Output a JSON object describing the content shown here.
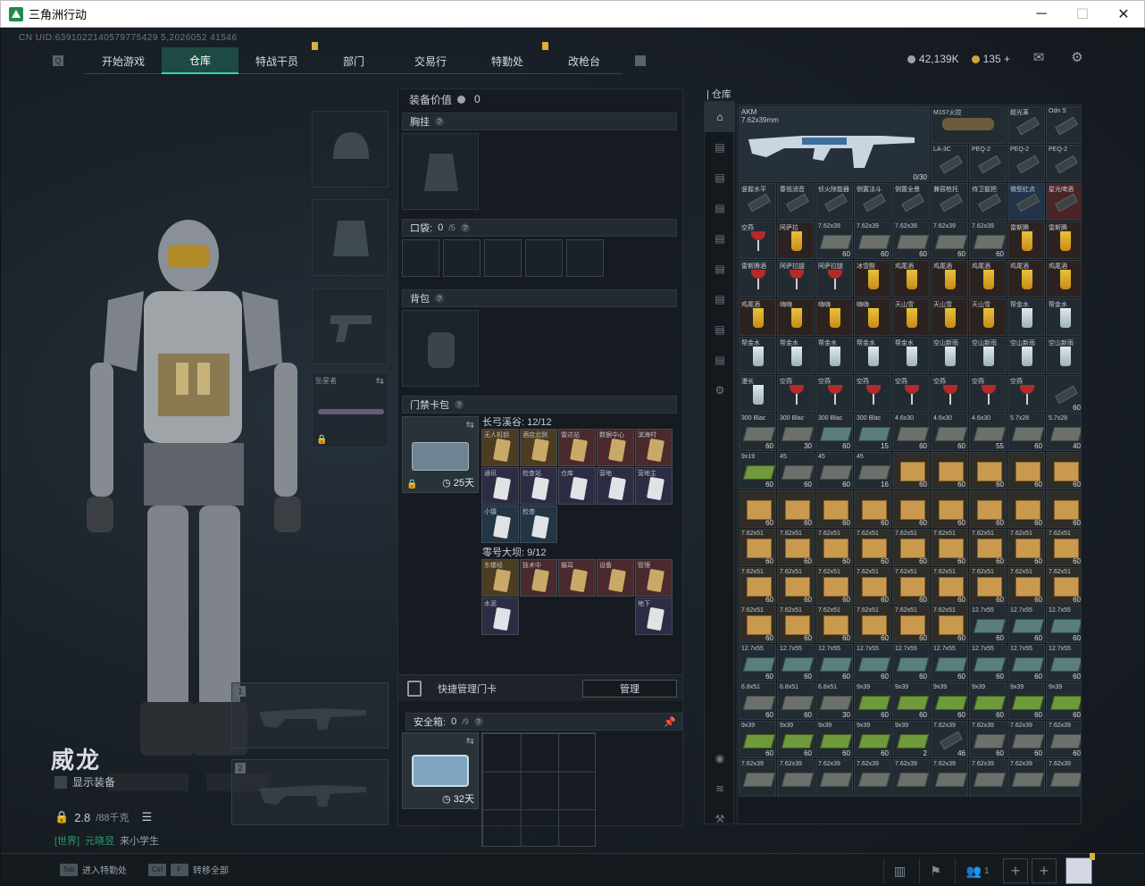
{
  "window": {
    "title": "三角洲行动",
    "min_icon": "minimize-icon",
    "max_icon": "maximize-icon",
    "close_icon": "close-icon"
  },
  "uid": "CN UID:6391022140579775429 5,2026052 41546",
  "nav": {
    "tabs": [
      {
        "label": "开始游戏"
      },
      {
        "label": "仓库",
        "active": true
      },
      {
        "label": "特战干员",
        "badge": true
      },
      {
        "label": "部门"
      },
      {
        "label": "交易行"
      },
      {
        "label": "特勤处",
        "badge": true
      },
      {
        "label": "改枪台"
      }
    ]
  },
  "currency": {
    "coins": "42,139K",
    "premium": "135",
    "plus": "+"
  },
  "character": {
    "name": "威龙",
    "show_gear": "显示装备",
    "weight": "2.8",
    "weight_max": "/88千克",
    "chat_channel": "[世界]",
    "chat_name": "元晓昱",
    "chat_text": "来小学生"
  },
  "melee": {
    "name": "坠星者"
  },
  "weapon_slots": {
    "slot1": "1",
    "slot2": "2"
  },
  "loadout": {
    "equip_value_label": "装备价值",
    "equip_value": "0",
    "chest_rig": "胸挂",
    "pockets": "口袋:",
    "pockets_count": "0",
    "pockets_max": "/5",
    "backpack": "背包",
    "keycase": "门禁卡包",
    "keycase_days": "25天",
    "zone1": "长弓溪谷: 12/12",
    "zone2": "零号大坝: 9/12",
    "quick_manage": "快捷管理门卡",
    "manage_btn": "管理",
    "safe_box": "安全箱:",
    "safe_count": "0",
    "safe_max": "/9",
    "safe_days": "32天"
  },
  "zone1_cards": [
    {
      "name": "无人机钥",
      "tone": "gold"
    },
    {
      "name": "酒店北侧",
      "tone": "gold"
    },
    {
      "name": "雷达站",
      "tone": "red"
    },
    {
      "name": "数据中心",
      "tone": "red"
    },
    {
      "name": "滨海村",
      "tone": "red"
    },
    {
      "name": "通讯",
      "tone": "purple"
    },
    {
      "name": "检查站",
      "tone": "purple"
    },
    {
      "name": "仓库",
      "tone": "purple"
    },
    {
      "name": "营地",
      "tone": "purple"
    },
    {
      "name": "营地主",
      "tone": "purple"
    },
    {
      "name": "小镇",
      "tone": "blue"
    },
    {
      "name": "检查",
      "tone": "blue"
    }
  ],
  "zone2_cards": [
    {
      "name": "东楼经",
      "tone": "gold"
    },
    {
      "name": "技术中",
      "tone": "red"
    },
    {
      "name": "猫耳",
      "tone": "red"
    },
    {
      "name": "设备",
      "tone": "red"
    },
    {
      "name": "管理",
      "tone": "red"
    },
    {
      "name": "水泥",
      "tone": "purple"
    },
    {
      "name": "",
      "tone": "empty"
    },
    {
      "name": "",
      "tone": "empty"
    },
    {
      "name": "",
      "tone": "empty"
    },
    {
      "name": "地下",
      "tone": "purple"
    }
  ],
  "warehouse": {
    "title": "仓库",
    "gun_name": "AKM",
    "gun_caliber": "7.62x39mm",
    "gun_ammo": "0/30",
    "scope_name": "M157火控",
    "tabs": [
      "home-icon",
      "ST",
      "ST",
      "SD",
      "TV",
      "TV",
      "TV",
      "TV",
      "TV",
      "settings-icon"
    ],
    "bottom_tabs": [
      "camera-icon",
      "layers-icon",
      "tool-icon"
    ]
  },
  "wh_small_top": [
    {
      "name": "超光革",
      "t": "att"
    },
    {
      "name": "Odn S",
      "t": "att"
    },
    {
      "name": "LA-3C",
      "t": "att"
    },
    {
      "name": "PEQ-2",
      "t": "att"
    },
    {
      "name": "PEQ-2",
      "t": "att"
    },
    {
      "name": "PEQ-2",
      "t": "att"
    }
  ],
  "wh_items": [
    {
      "name": "竖握水平",
      "t": "att"
    },
    {
      "name": "春祖消音",
      "t": "att"
    },
    {
      "name": "侦火除能器",
      "t": "att"
    },
    {
      "name": "侧置法斗",
      "t": "att"
    },
    {
      "name": "侧置全景",
      "t": "att"
    },
    {
      "name": "兼容枪托",
      "t": "att"
    },
    {
      "name": "侍卫握把",
      "t": "att"
    },
    {
      "name": "微型红点",
      "t": "att blue"
    },
    {
      "name": "星光啤酒",
      "t": "att red"
    },
    {
      "name": "空燕",
      "t": "drinkr"
    },
    {
      "name": "阿萨拉",
      "t": "drink"
    },
    {
      "name": "7.62x39",
      "t": "ammo",
      "c": "60"
    },
    {
      "name": "7.62x39",
      "t": "ammo",
      "c": "60"
    },
    {
      "name": "7.62x39",
      "t": "ammo",
      "c": "60"
    },
    {
      "name": "7.62x39",
      "t": "ammo",
      "c": "60"
    },
    {
      "name": "7.62x39",
      "t": "ammo",
      "c": "60"
    },
    {
      "name": "雷斯腾",
      "t": "drink"
    },
    {
      "name": "雷斯腾",
      "t": "drink"
    },
    {
      "name": "雷斯腾酒",
      "t": "drinkr"
    },
    {
      "name": "阿萨拉腿",
      "t": "drinkr"
    },
    {
      "name": "阿萨拉腿",
      "t": "drinkr"
    },
    {
      "name": "冰雪酸",
      "t": "drink"
    },
    {
      "name": "鸡尾酒",
      "t": "drink"
    },
    {
      "name": "鸡尾酒",
      "t": "drink"
    },
    {
      "name": "鸡尾酒",
      "t": "drink"
    },
    {
      "name": "鸡尾酒",
      "t": "drink"
    },
    {
      "name": "鸡尾酒",
      "t": "drink"
    },
    {
      "name": "鸡尾酒",
      "t": "drink"
    },
    {
      "name": "嗨嗨",
      "t": "drink"
    },
    {
      "name": "嗨嗨",
      "t": "drink"
    },
    {
      "name": "嗨嗨",
      "t": "drink"
    },
    {
      "name": "天山雪",
      "t": "drink"
    },
    {
      "name": "天山雪",
      "t": "drink"
    },
    {
      "name": "天山雪",
      "t": "drink"
    },
    {
      "name": "帮金水",
      "t": "drinkc"
    },
    {
      "name": "帮金水",
      "t": "drinkc"
    },
    {
      "name": "帮金水",
      "t": "drinkc"
    },
    {
      "name": "帮金水",
      "t": "drinkc"
    },
    {
      "name": "帮金水",
      "t": "drinkc"
    },
    {
      "name": "帮金水",
      "t": "drinkc"
    },
    {
      "name": "帮金水",
      "t": "drinkc"
    },
    {
      "name": "空山新雨",
      "t": "drinkc"
    },
    {
      "name": "空山新雨",
      "t": "drinkc"
    },
    {
      "name": "空山新雨",
      "t": "drinkc"
    },
    {
      "name": "空山新雨",
      "t": "drinkc"
    },
    {
      "name": "漫长",
      "t": "drinkc"
    },
    {
      "name": "空燕",
      "t": "drinkr"
    },
    {
      "name": "空燕",
      "t": "drinkr"
    },
    {
      "name": "空燕",
      "t": "drinkr"
    },
    {
      "name": "空燕",
      "t": "drinkr"
    },
    {
      "name": "空燕",
      "t": "drinkr"
    },
    {
      "name": "空燕",
      "t": "drinkr"
    },
    {
      "name": "空燕",
      "t": "drinkr"
    },
    {
      "name": "",
      "t": "att",
      "c": "60"
    },
    {
      "name": "300 Blac",
      "t": "ammo",
      "c": "60"
    },
    {
      "name": "300 Blac",
      "t": "ammo",
      "c": "30"
    },
    {
      "name": "300 Blac",
      "t": "ammob",
      "c": "60"
    },
    {
      "name": "300 Blac",
      "t": "ammob",
      "c": "15"
    },
    {
      "name": "4.6x30",
      "t": "ammo",
      "c": "60"
    },
    {
      "name": "4.6x30",
      "t": "ammo",
      "c": "60"
    },
    {
      "name": "4.6x30",
      "t": "ammo",
      "c": "55"
    },
    {
      "name": "5.7x28",
      "t": "ammo",
      "c": "60"
    },
    {
      "name": "5.7x28",
      "t": "ammo",
      "c": "40"
    },
    {
      "name": "9x19",
      "t": "ammog",
      "c": "60"
    },
    {
      "name": "45",
      "t": "ammo",
      "c": "60"
    },
    {
      "name": "45",
      "t": "ammo",
      "c": "60"
    },
    {
      "name": "45",
      "t": "ammo",
      "c": "16"
    },
    {
      "name": "",
      "t": "crate",
      "c": "60"
    },
    {
      "name": "",
      "t": "crate",
      "c": "60"
    },
    {
      "name": "",
      "t": "crate",
      "c": "60"
    },
    {
      "name": "",
      "t": "crate",
      "c": "60"
    },
    {
      "name": "",
      "t": "crate",
      "c": "60"
    },
    {
      "name": "",
      "t": "crate",
      "c": "60"
    },
    {
      "name": "",
      "t": "crate",
      "c": "60"
    },
    {
      "name": "",
      "t": "crate",
      "c": "60"
    },
    {
      "name": "",
      "t": "crate",
      "c": "60"
    },
    {
      "name": "",
      "t": "crate",
      "c": "60"
    },
    {
      "name": "",
      "t": "crate",
      "c": "60"
    },
    {
      "name": "",
      "t": "crate",
      "c": "60"
    },
    {
      "name": "",
      "t": "crate",
      "c": "60"
    },
    {
      "name": "",
      "t": "crate",
      "c": "60"
    },
    {
      "name": "7.62x51",
      "t": "crate",
      "c": "60"
    },
    {
      "name": "7.62x51",
      "t": "crate",
      "c": "60"
    },
    {
      "name": "7.62x51",
      "t": "crate",
      "c": "60"
    },
    {
      "name": "7.62x51",
      "t": "crate",
      "c": "60"
    },
    {
      "name": "7.62x51",
      "t": "crate",
      "c": "60"
    },
    {
      "name": "7.62x51",
      "t": "crate",
      "c": "60"
    },
    {
      "name": "7.62x51",
      "t": "crate",
      "c": "60"
    },
    {
      "name": "7.62x51",
      "t": "crate",
      "c": "60"
    },
    {
      "name": "7.62x51",
      "t": "crate",
      "c": "60"
    },
    {
      "name": "7.62x51",
      "t": "crate",
      "c": "60"
    },
    {
      "name": "7.62x51",
      "t": "crate",
      "c": "60"
    },
    {
      "name": "7.62x51",
      "t": "crate",
      "c": "60"
    },
    {
      "name": "7.62x51",
      "t": "crate",
      "c": "60"
    },
    {
      "name": "7.62x51",
      "t": "crate",
      "c": "60"
    },
    {
      "name": "7.62x51",
      "t": "crate",
      "c": "60"
    },
    {
      "name": "7.62x51",
      "t": "crate",
      "c": "60"
    },
    {
      "name": "7.62x51",
      "t": "crate",
      "c": "60"
    },
    {
      "name": "7.62x51",
      "t": "crate",
      "c": "60"
    },
    {
      "name": "7.62x51",
      "t": "crate",
      "c": "60"
    },
    {
      "name": "7.62x51",
      "t": "crate",
      "c": "60"
    },
    {
      "name": "7.62x51",
      "t": "crate",
      "c": "60"
    },
    {
      "name": "7.62x51",
      "t": "crate",
      "c": "60"
    },
    {
      "name": "7.62x51",
      "t": "crate",
      "c": "60"
    },
    {
      "name": "7.62x51",
      "t": "crate",
      "c": "60"
    },
    {
      "name": "12.7x55",
      "t": "ammob",
      "c": "60"
    },
    {
      "name": "12.7x55",
      "t": "ammob",
      "c": "60"
    },
    {
      "name": "12.7x55",
      "t": "ammob",
      "c": "60"
    },
    {
      "name": "12.7x55",
      "t": "ammob",
      "c": "60"
    },
    {
      "name": "12.7x55",
      "t": "ammob",
      "c": "60"
    },
    {
      "name": "12.7x55",
      "t": "ammob",
      "c": "60"
    },
    {
      "name": "12.7x55",
      "t": "ammob",
      "c": "60"
    },
    {
      "name": "12.7x55",
      "t": "ammob",
      "c": "60"
    },
    {
      "name": "12.7x55",
      "t": "ammob",
      "c": "60"
    },
    {
      "name": "12.7x55",
      "t": "ammob",
      "c": "60"
    },
    {
      "name": "12.7x55",
      "t": "ammob",
      "c": "60"
    },
    {
      "name": "12.7x55",
      "t": "ammob",
      "c": "60"
    },
    {
      "name": "6.8x51",
      "t": "ammo",
      "c": "60"
    },
    {
      "name": "6.8x51",
      "t": "ammo",
      "c": "60"
    },
    {
      "name": "6.8x51",
      "t": "ammo",
      "c": "30"
    },
    {
      "name": "9x39",
      "t": "ammog",
      "c": "60"
    },
    {
      "name": "9x39",
      "t": "ammog",
      "c": "60"
    },
    {
      "name": "9x39",
      "t": "ammog",
      "c": "60"
    },
    {
      "name": "9x39",
      "t": "ammog",
      "c": "60"
    },
    {
      "name": "9x39",
      "t": "ammog",
      "c": "60"
    },
    {
      "name": "9x39",
      "t": "ammog",
      "c": "60"
    },
    {
      "name": "9x39",
      "t": "ammog",
      "c": "60"
    },
    {
      "name": "9x39",
      "t": "ammog",
      "c": "60"
    },
    {
      "name": "9x39",
      "t": "ammog",
      "c": "60"
    },
    {
      "name": "9x39",
      "t": "ammog",
      "c": "60"
    },
    {
      "name": "9x39",
      "t": "ammog",
      "c": "2"
    },
    {
      "name": "7.62x39",
      "t": "att",
      "c": "46"
    },
    {
      "name": "7.62x39",
      "t": "ammo",
      "c": "60"
    },
    {
      "name": "7.62x39",
      "t": "ammo",
      "c": "60"
    },
    {
      "name": "7.62x39",
      "t": "ammo",
      "c": "60"
    },
    {
      "name": "7.62x39",
      "t": "ammo",
      "c": ""
    },
    {
      "name": "7.62x39",
      "t": "ammo",
      "c": ""
    },
    {
      "name": "7.62x39",
      "t": "ammo",
      "c": ""
    },
    {
      "name": "7.62x39",
      "t": "ammo",
      "c": ""
    },
    {
      "name": "7.62x39",
      "t": "ammo",
      "c": ""
    },
    {
      "name": "7.62x39",
      "t": "ammo",
      "c": ""
    },
    {
      "name": "7.62x39",
      "t": "ammo",
      "c": ""
    },
    {
      "name": "7.62x39",
      "t": "ammo",
      "c": ""
    },
    {
      "name": "7.62x39",
      "t": "ammo",
      "c": ""
    }
  ],
  "bottom": {
    "tab_key": "Tab",
    "tab_label": "进入特勤处",
    "ctrl_key": "Ctrl",
    "f_key": "F",
    "ctrl_label": "转移全部",
    "friends_count": "1"
  }
}
